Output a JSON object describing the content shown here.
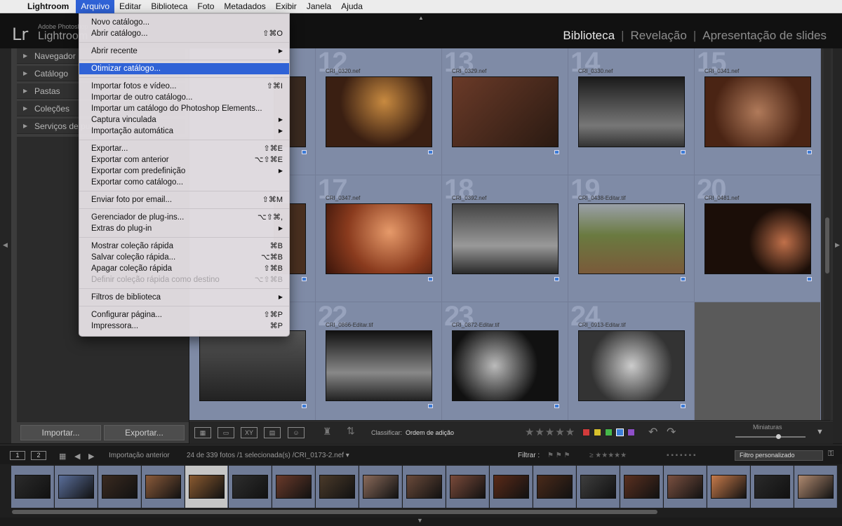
{
  "menubar": {
    "app_name": "Lightroom",
    "items": [
      "Arquivo",
      "Editar",
      "Biblioteca",
      "Foto",
      "Metadados",
      "Exibir",
      "Janela",
      "Ajuda"
    ],
    "active": "Arquivo"
  },
  "header": {
    "logo": "Lr",
    "brand_line1": "Adobe Photoshop",
    "brand_line2": "Lightroom",
    "modules": [
      "Biblioteca",
      "Revelação",
      "Apresentação de slides"
    ],
    "active_module": "Biblioteca",
    "separator": "|"
  },
  "left_panel": {
    "sections": [
      "Navegador",
      "Catálogo",
      "Pastas",
      "Coleções",
      "Serviços de publicação"
    ],
    "import_button": "Importar...",
    "export_button": "Exportar..."
  },
  "file_menu": {
    "groups": [
      [
        {
          "label": "Novo catálogo...",
          "shortcut": ""
        },
        {
          "label": "Abrir catálogo...",
          "shortcut": "⇧⌘O"
        }
      ],
      [
        {
          "label": "Abrir recente",
          "shortcut": "▶"
        }
      ],
      [
        {
          "label": "Otimizar catálogo...",
          "shortcut": "",
          "highlighted": true
        }
      ],
      [
        {
          "label": "Importar fotos e vídeo...",
          "shortcut": "⇧⌘I"
        },
        {
          "label": "Importar de outro catálogo...",
          "shortcut": ""
        },
        {
          "label": "Importar um catálogo do Photoshop Elements...",
          "shortcut": ""
        },
        {
          "label": "Captura vinculada",
          "shortcut": "▶"
        },
        {
          "label": "Importação automática",
          "shortcut": "▶"
        }
      ],
      [
        {
          "label": "Exportar...",
          "shortcut": "⇧⌘E"
        },
        {
          "label": "Exportar com anterior",
          "shortcut": "⌥⇧⌘E"
        },
        {
          "label": "Exportar com predefinição",
          "shortcut": "▶"
        },
        {
          "label": "Exportar como catálogo...",
          "shortcut": ""
        }
      ],
      [
        {
          "label": "Enviar foto por email...",
          "shortcut": "⇧⌘M"
        }
      ],
      [
        {
          "label": "Gerenciador de plug-ins...",
          "shortcut": "⌥⇧⌘,"
        },
        {
          "label": "Extras do plug-in",
          "shortcut": "▶"
        }
      ],
      [
        {
          "label": "Mostrar coleção rápida",
          "shortcut": "⌘B"
        },
        {
          "label": "Salvar coleção rápida...",
          "shortcut": "⌥⌘B"
        },
        {
          "label": "Apagar coleção rápida",
          "shortcut": "⇧⌘B"
        },
        {
          "label": "Definir coleção rápida como destino",
          "shortcut": "⌥⇧⌘B",
          "disabled": true
        }
      ],
      [
        {
          "label": "Filtros de biblioteca",
          "shortcut": "▶"
        }
      ],
      [
        {
          "label": "Configurar página...",
          "shortcut": "⇧⌘P"
        },
        {
          "label": "Impressora...",
          "shortcut": "⌘P"
        }
      ]
    ]
  },
  "grid": {
    "cells": [
      {
        "num": "12",
        "file": "CRI_0320.nef",
        "tone": "#3a1f12"
      },
      {
        "num": "13",
        "file": "CRI_0329.nef",
        "tone": "#4a2418"
      },
      {
        "num": "14",
        "file": "CRI_0330.nef",
        "tone": "#3b3b3b"
      },
      {
        "num": "15",
        "file": "CRI_0341.nef",
        "tone": "#5a2d1a"
      },
      {
        "num": "17",
        "file": "CRI_0347.nef",
        "tone": "#8a3b1e"
      },
      {
        "num": "18",
        "file": "CRI_0392.nef",
        "tone": "#3a3a3a"
      },
      {
        "num": "19",
        "file": "CRI_0438-Editar.tif",
        "tone": "#6a6a3a"
      },
      {
        "num": "20",
        "file": "CRI_0481.nef",
        "tone": "#1b0e08"
      },
      {
        "num": "22",
        "file": "CRI_0866-Editar.tif",
        "tone": "#2a2a2a"
      },
      {
        "num": "23",
        "file": "CRI_0872-Editar.tif",
        "tone": "#262626"
      },
      {
        "num": "24",
        "file": "CRI_0913-Editar.tif",
        "tone": "#3e3e3e"
      }
    ],
    "partial_thumbs": [
      "#3a2a20",
      "#4a3020",
      "#2e2e2e"
    ]
  },
  "toolbar": {
    "sort_label": "Classificar:",
    "sort_value": "Ordem de adição",
    "stars": "★★★★★",
    "color_labels": [
      "#d23b3b",
      "#d8c12c",
      "#45b84a",
      "#3c7ed8",
      "#8e4fc8"
    ],
    "thumbnails_label": "Miniaturas"
  },
  "filmbar": {
    "screen1": "1",
    "screen2": "2",
    "source": "Importação anterior",
    "count": "24 de 339 fotos /1 selecionada(s) /CRI_0173-2.nef ▾",
    "filter_label": "Filtrar :",
    "filter_value": "Filtro personalizado"
  },
  "filmstrip": {
    "tones": [
      "#2b2b2b",
      "#5a6e9a",
      "#3a2a20",
      "#8a5a3a",
      "#8a5a30",
      "#2e2e2e",
      "#6a3a2a",
      "#4a3a2a",
      "#8a6a5a",
      "#6a4a3a",
      "#7a4a3a",
      "#5a2a18",
      "#4a2a1a",
      "#3e3e3e",
      "#5a3020",
      "#7a5040",
      "#c77a4a",
      "#2a2a2a",
      "#b08a70"
    ],
    "selected_index": 4
  }
}
